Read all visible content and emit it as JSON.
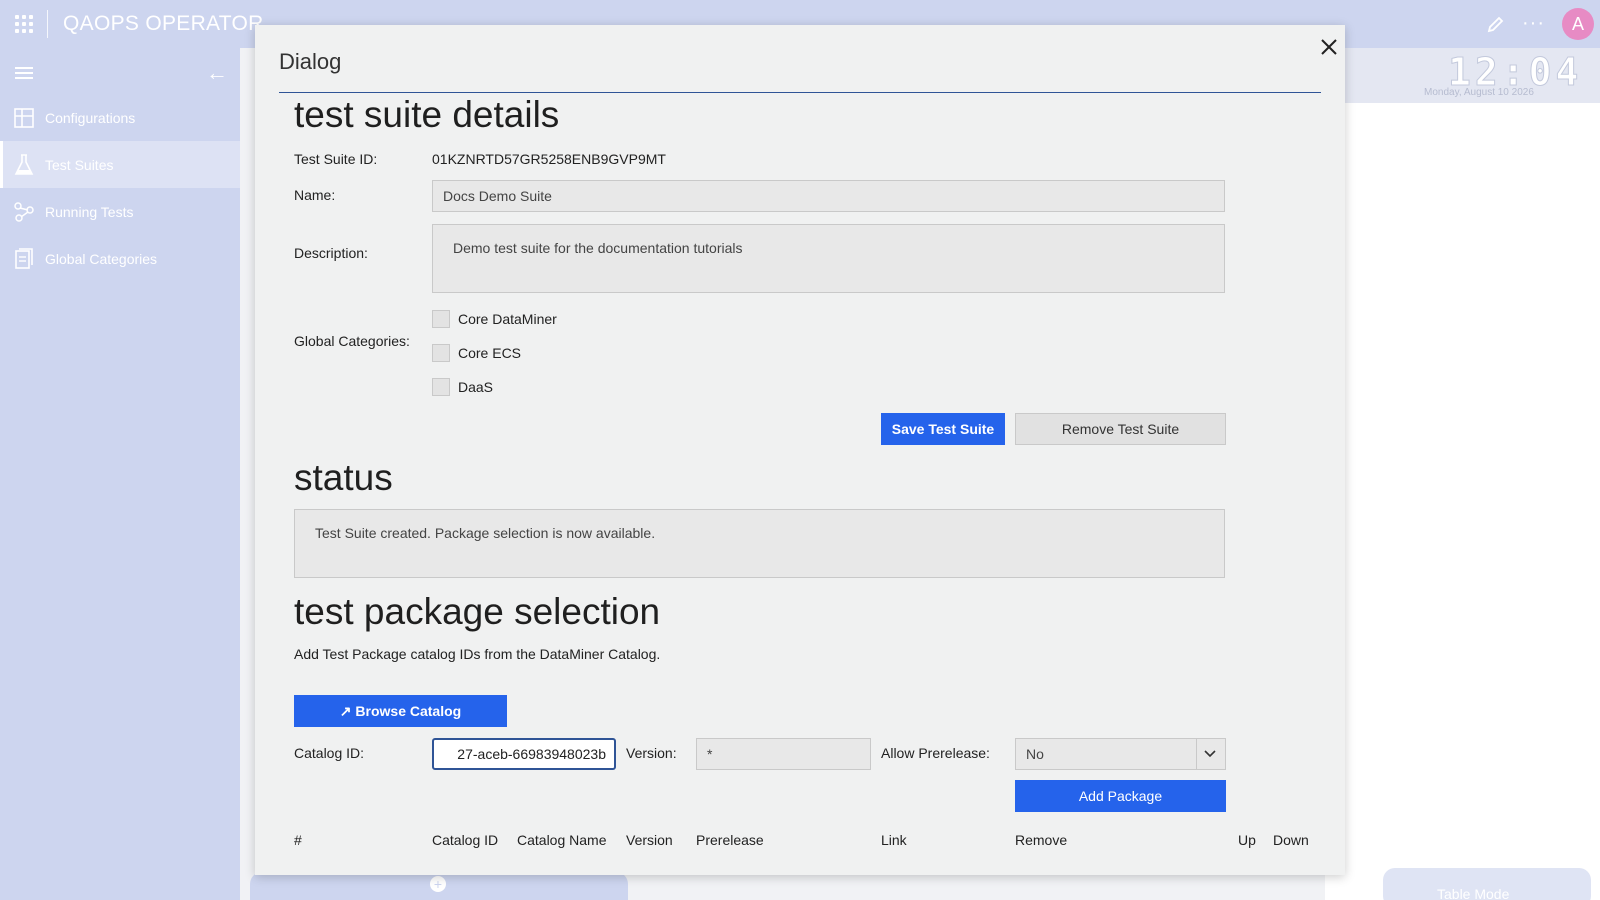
{
  "app": {
    "title": "QAOPS OPERATOR",
    "avatar_letter": "A",
    "more_label": "···"
  },
  "sidebar": {
    "items": [
      {
        "label": "Configurations",
        "icon": "layout-icon"
      },
      {
        "label": "Test Suites",
        "icon": "flask-icon"
      },
      {
        "label": "Running Tests",
        "icon": "flow-icon"
      },
      {
        "label": "Global Categories",
        "icon": "document-icon"
      }
    ]
  },
  "background": {
    "clock": "12:04",
    "date": "Monday, August 10 2026",
    "table_mode_label": "Table Mode"
  },
  "dialog": {
    "title": "Dialog",
    "details": {
      "heading": "test suite details",
      "id_label": "Test Suite ID:",
      "id_value": "01KZNRTD57GR5258ENB9GVP9MT",
      "name_label": "Name:",
      "name_value": "Docs Demo Suite",
      "description_label": "Description:",
      "description_value": "Demo test suite for the documentation tutorials",
      "categories_label": "Global Categories:",
      "categories": [
        "Core DataMiner",
        "Core ECS",
        "DaaS"
      ],
      "save_label": "Save Test Suite",
      "remove_label": "Remove Test Suite"
    },
    "status": {
      "heading": "status",
      "message": "Test Suite created. Package selection is now available."
    },
    "packages": {
      "heading": "test package selection",
      "intro": "Add Test Package catalog IDs from the DataMiner Catalog.",
      "browse_label": "↗ Browse Catalog",
      "catalog_id_label": "Catalog ID:",
      "catalog_id_value": "27-aceb-66983948023b",
      "version_label": "Version:",
      "version_value": "*",
      "prerelease_label": "Allow Prerelease:",
      "prerelease_value": "No",
      "add_label": "Add Package",
      "columns": [
        "#",
        "Catalog ID",
        "Catalog Name",
        "Version",
        "Prerelease",
        "Link",
        "Remove",
        "Up",
        "Down"
      ]
    }
  },
  "colors": {
    "primary": "#2563eb",
    "sidebar": "#cdd5ef",
    "dialog_bg": "#f0f1f1"
  }
}
